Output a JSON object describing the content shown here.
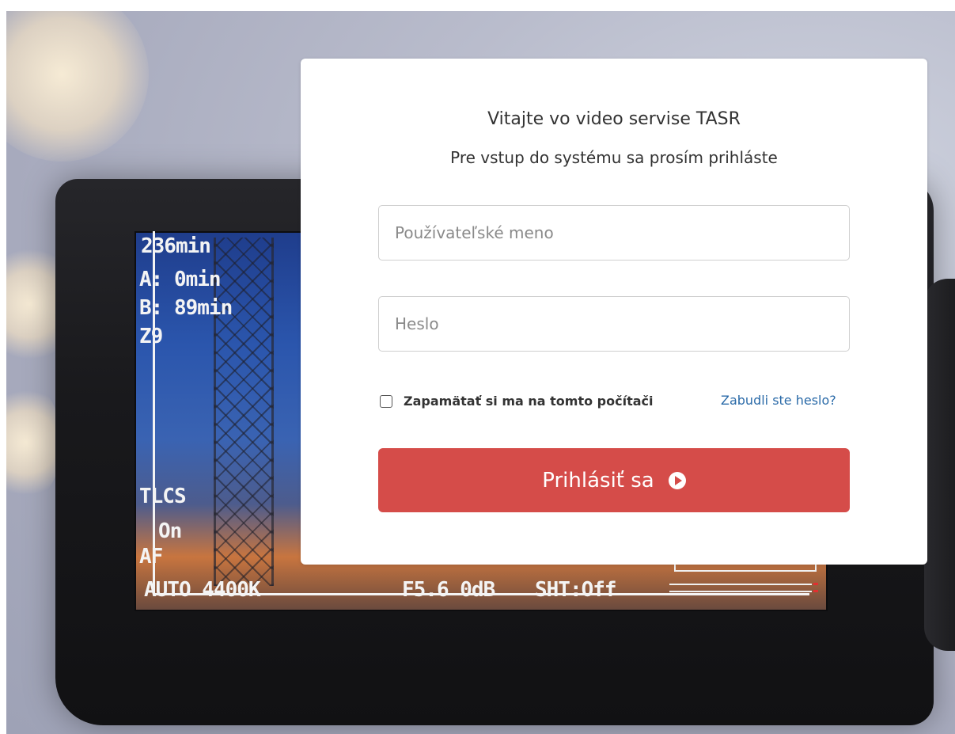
{
  "background": {
    "osd": {
      "battery": "236min",
      "a_time": "A:  0min",
      "b_time": "B: 89min",
      "zoom": "Z9",
      "tlcs": "TLCS",
      "stabilizer": "On",
      "af": "AF",
      "wb": "AUTO 4400K",
      "exposure": "F5.6 0dB",
      "shutter": "SHT:Off"
    }
  },
  "login": {
    "title": "Vitajte vo video servise TASR",
    "subtitle": "Pre vstup do systému sa prosím prihláste",
    "username_placeholder": "Používateľské meno",
    "username_value": "",
    "password_placeholder": "Heslo",
    "password_value": "",
    "remember_label": "Zapamätať si ma na tomto počítači",
    "remember_checked": false,
    "forgot_label": "Zabudli ste heslo?",
    "submit_label": "Prihlásiť sa",
    "submit_icon": "play-circle-icon",
    "submit_color": "#d54c49",
    "link_color": "#2a6aa8"
  }
}
